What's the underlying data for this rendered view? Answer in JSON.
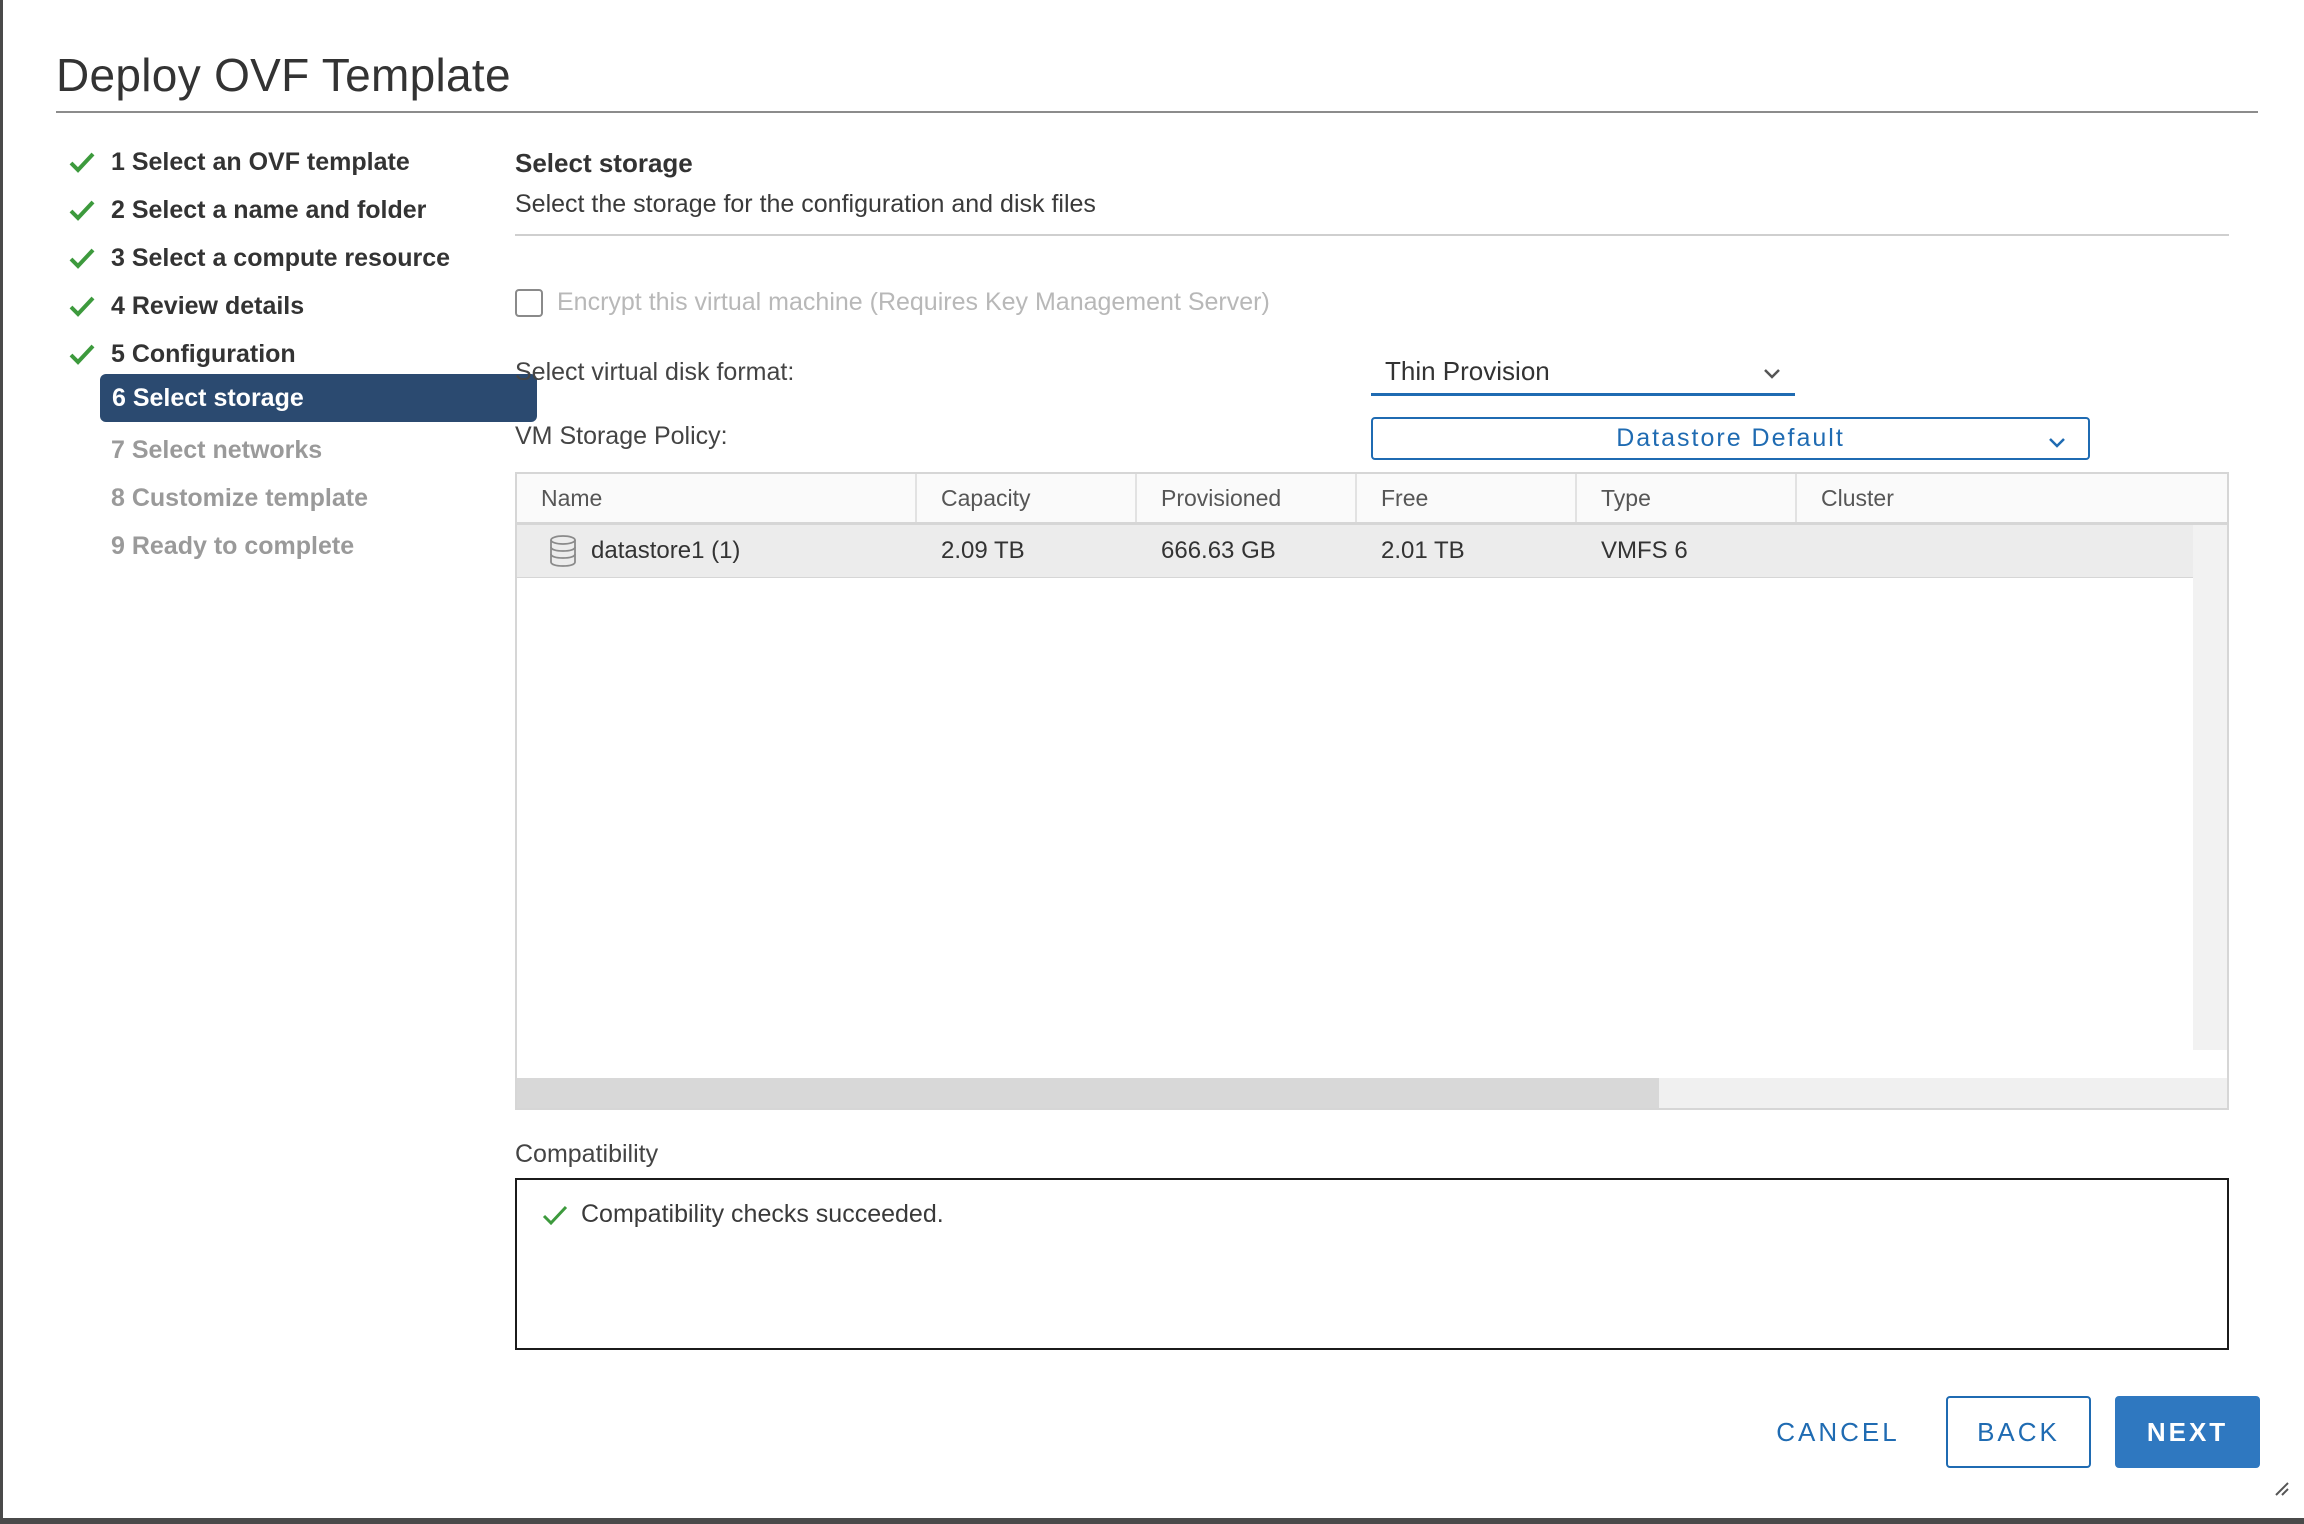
{
  "dialog": {
    "title": "Deploy OVF Template"
  },
  "steps": [
    {
      "label": "1 Select an OVF template",
      "state": "done"
    },
    {
      "label": "2 Select a name and folder",
      "state": "done"
    },
    {
      "label": "3 Select a compute resource",
      "state": "done"
    },
    {
      "label": "4 Review details",
      "state": "done"
    },
    {
      "label": "5 Configuration",
      "state": "done"
    },
    {
      "label": "6 Select storage",
      "state": "active"
    },
    {
      "label": "7 Select networks",
      "state": "future"
    },
    {
      "label": "8 Customize template",
      "state": "future"
    },
    {
      "label": "9 Ready to complete",
      "state": "future"
    }
  ],
  "main": {
    "title": "Select storage",
    "subtitle": "Select the storage for the configuration and disk files",
    "encrypt_label": "Encrypt this virtual machine (Requires Key Management Server)",
    "encrypt_checked": false,
    "disk_format_label": "Select virtual disk format:",
    "disk_format_value": "Thin Provision",
    "storage_policy_label": "VM Storage Policy:",
    "storage_policy_value": "Datastore Default"
  },
  "grid": {
    "columns": [
      "Name",
      "Capacity",
      "Provisioned",
      "Free",
      "Type",
      "Cluster"
    ],
    "rows": [
      {
        "name": "datastore1 (1)",
        "capacity": "2.09 TB",
        "provisioned": "666.63 GB",
        "free": "2.01 TB",
        "type": "VMFS 6",
        "cluster": ""
      }
    ]
  },
  "compatibility": {
    "label": "Compatibility",
    "message": "Compatibility checks succeeded."
  },
  "buttons": {
    "cancel": "CANCEL",
    "back": "BACK",
    "next": "NEXT"
  },
  "colors": {
    "accent": "#1f6bb2",
    "active_step_bg": "#2b4a70",
    "check_green": "#3d9a3d"
  },
  "icons": {
    "done_step": "check-icon",
    "datastore": "database-icon",
    "dropdown": "chevron-down-icon"
  }
}
